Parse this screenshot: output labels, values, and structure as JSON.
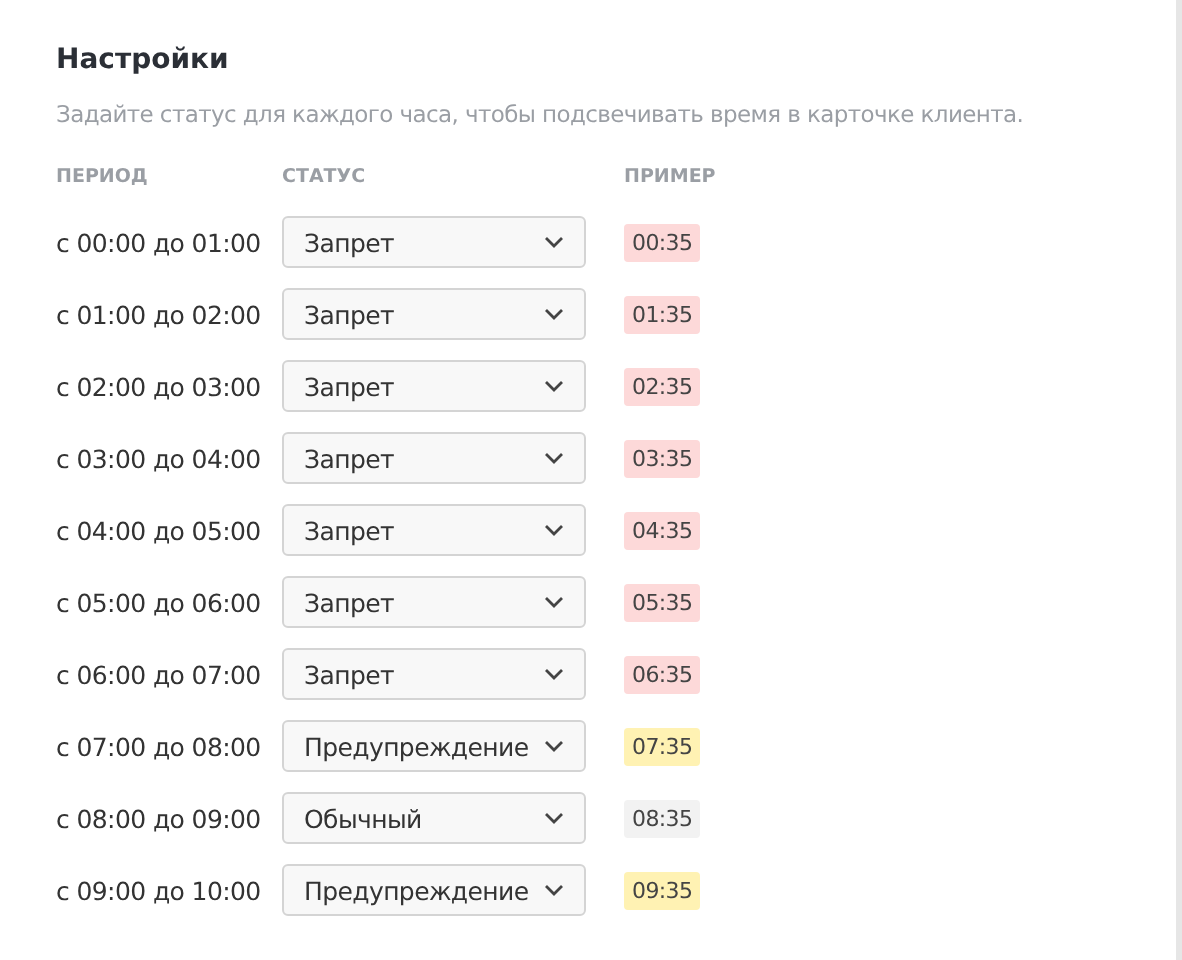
{
  "title": "Настройки",
  "description": "Задайте статус для каждого часа, чтобы подсвечивать время в карточке клиента.",
  "table": {
    "columns": [
      "ПЕРИОД",
      "СТАТУС",
      "ПРИМЕР"
    ],
    "rows": [
      {
        "period": "с 00:00 до 01:00",
        "status": "Запрет",
        "kind": "forbidden",
        "example": "00:35"
      },
      {
        "period": "с 01:00 до 02:00",
        "status": "Запрет",
        "kind": "forbidden",
        "example": "01:35"
      },
      {
        "period": "с 02:00 до 03:00",
        "status": "Запрет",
        "kind": "forbidden",
        "example": "02:35"
      },
      {
        "period": "с 03:00 до 04:00",
        "status": "Запрет",
        "kind": "forbidden",
        "example": "03:35"
      },
      {
        "period": "с 04:00 до 05:00",
        "status": "Запрет",
        "kind": "forbidden",
        "example": "04:35"
      },
      {
        "period": "с 05:00 до 06:00",
        "status": "Запрет",
        "kind": "forbidden",
        "example": "05:35"
      },
      {
        "period": "с 06:00 до 07:00",
        "status": "Запрет",
        "kind": "forbidden",
        "example": "06:35"
      },
      {
        "period": "с 07:00 до 08:00",
        "status": "Предупреждение",
        "kind": "warning",
        "example": "07:35"
      },
      {
        "period": "с 08:00 до 09:00",
        "status": "Обычный",
        "kind": "normal",
        "example": "08:35"
      },
      {
        "period": "с 09:00 до 10:00",
        "status": "Предупреждение",
        "kind": "warning",
        "example": "09:35"
      }
    ]
  }
}
